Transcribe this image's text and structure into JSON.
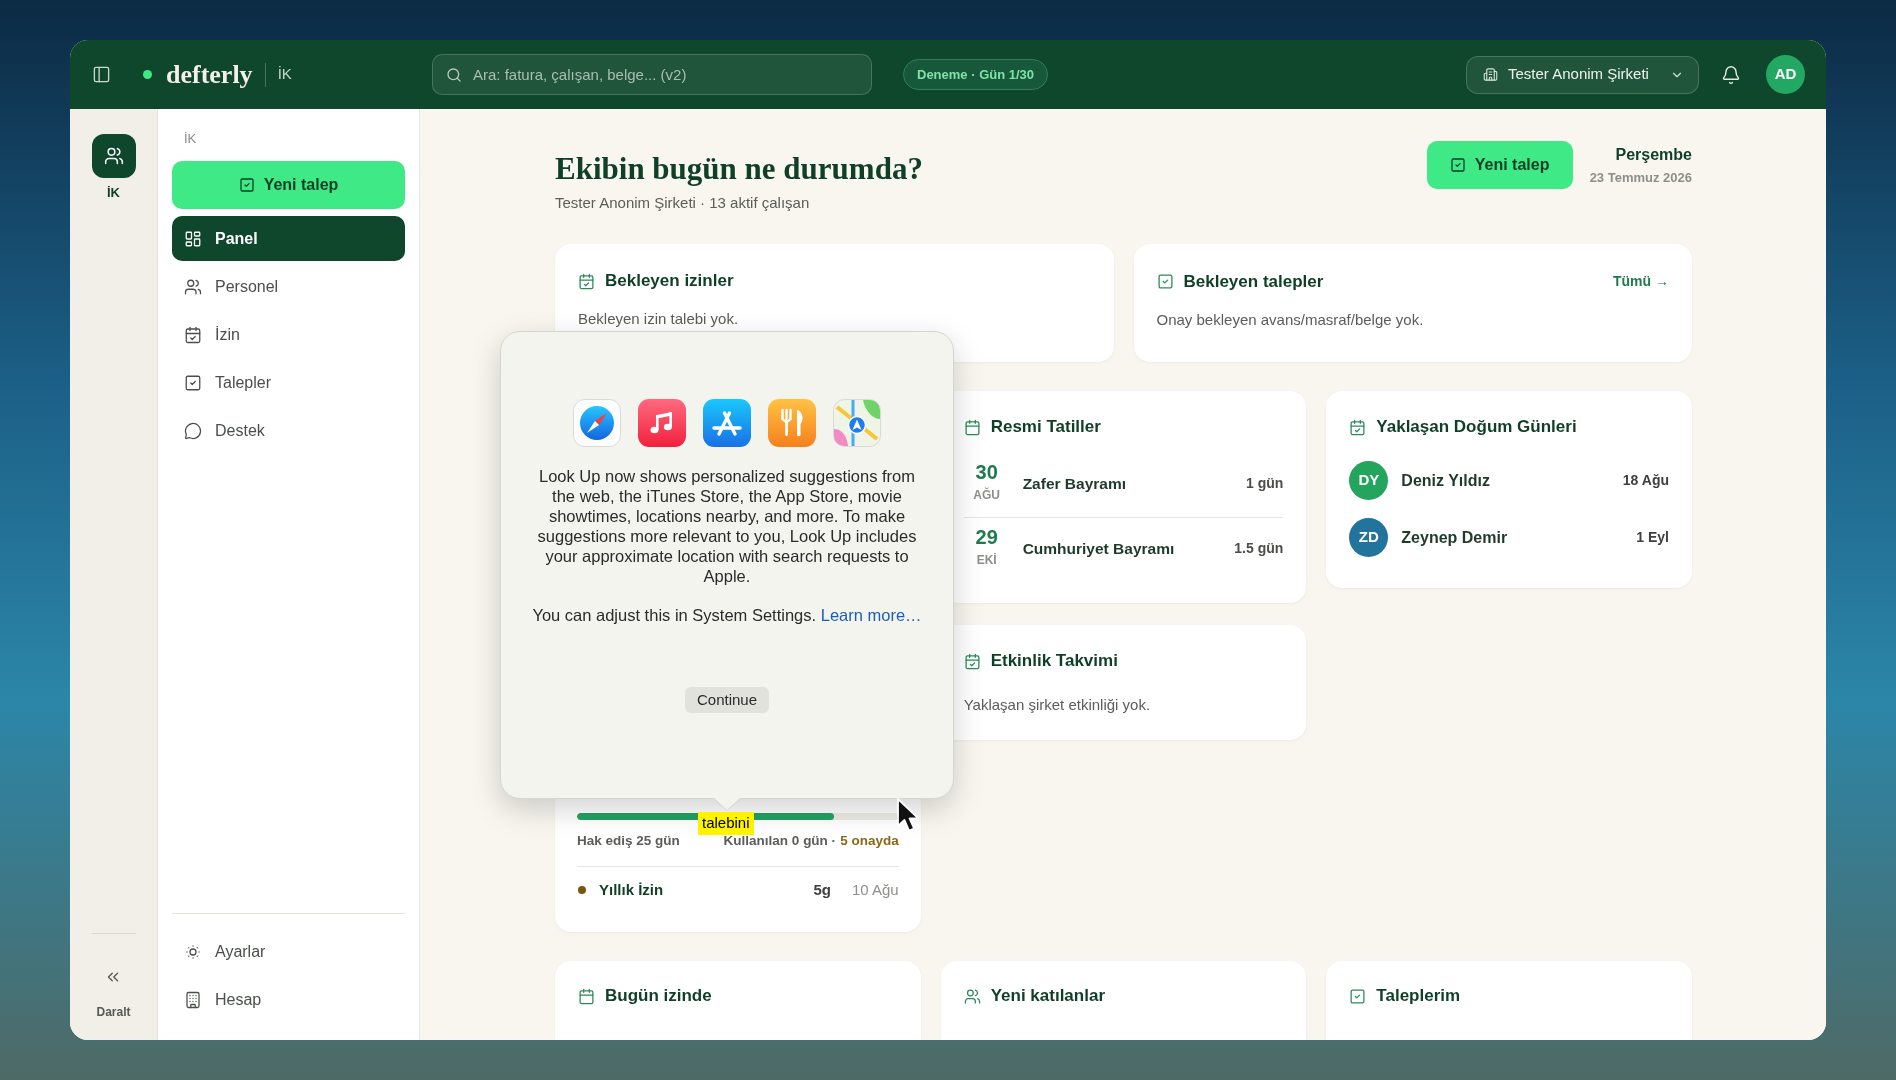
{
  "topbar": {
    "brand": "defterly",
    "module": "İK",
    "search": {
      "placeholder": "Ara: fatura, çalışan, belge... (v2)"
    },
    "trial_badge": "Deneme · Gün 1/30",
    "company": "Tester Anonim Şirketi",
    "avatar": "AD"
  },
  "rail": {
    "items": [
      {
        "label": "İK",
        "selected": true
      }
    ],
    "collapse": "Daralt"
  },
  "sidebar": {
    "section": "İK",
    "new_request": "Yeni talep",
    "items": [
      {
        "label": "Panel",
        "selected": true
      },
      {
        "label": "Personel",
        "selected": false
      },
      {
        "label": "İzin",
        "selected": false
      },
      {
        "label": "Talepler",
        "selected": false
      },
      {
        "label": "Destek",
        "selected": false
      }
    ],
    "footer_items": [
      {
        "label": "Ayarlar"
      },
      {
        "label": "Hesap"
      }
    ]
  },
  "header": {
    "title": "Ekibin bugün ne durumda?",
    "subtitle": "Tester Anonim Şirketi · 13 aktif çalışan",
    "new_request": "Yeni talep",
    "day": "Perşembe",
    "date": "23 Temmuz 2026"
  },
  "pending_leaves": {
    "title": "Bekleyen izinler",
    "empty_text": "Bekleyen izin talebi yok."
  },
  "pending_requests": {
    "title": "Bekleyen talepler",
    "link": "Tümü →",
    "empty_text": "Onay bekleyen avans/masraf/belge yok."
  },
  "leave_balance": {
    "level": 0.8,
    "entitled": "Hak ediş 25 gün",
    "used": "Kullanılan 0 gün ·",
    "pending": "5 onayda",
    "leaves": [
      {
        "name": "Yıllık İzin",
        "color": "#7a5510",
        "days": "5g",
        "date": "10 Ağu"
      }
    ]
  },
  "holidays": {
    "title": "Resmi Tatiller",
    "items": [
      {
        "day": "30",
        "month": "AĞU",
        "name": "Zafer Bayramı",
        "duration": "1 gün"
      },
      {
        "day": "29",
        "month": "EKİ",
        "name": "Cumhuriyet Bayramı",
        "duration": "1.5 gün"
      }
    ]
  },
  "events": {
    "title": "Etkinlik Takvimi",
    "empty_text": "Yaklaşan şirket etkinliği yok."
  },
  "birthdays": {
    "title": "Yaklaşan Doğum Günleri",
    "items": [
      {
        "initials": "DY",
        "name": "Deniz Yıldız",
        "date": "18 Ağu",
        "color": "#23a55e"
      },
      {
        "initials": "ZD",
        "name": "Zeynep Demir",
        "date": "1 Eyl",
        "color": "#22749c"
      }
    ]
  },
  "bottom_cards": [
    {
      "title": "Bugün izinde"
    },
    {
      "title": "Yeni katılanlar"
    },
    {
      "title": "Taleplerim"
    }
  ],
  "lookup_popover": {
    "text": "Look Up now shows personalized suggestions from the web, the iTunes Store, the App Store, movie showtimes, locations nearby, and more. To make suggestions more relevant to you, Look Up includes your approximate location with search requests to Apple.",
    "settings_text": "You can adjust this in System Settings.",
    "link": "Learn more…",
    "button": "Continue"
  },
  "lookup_highlight": "talebini"
}
